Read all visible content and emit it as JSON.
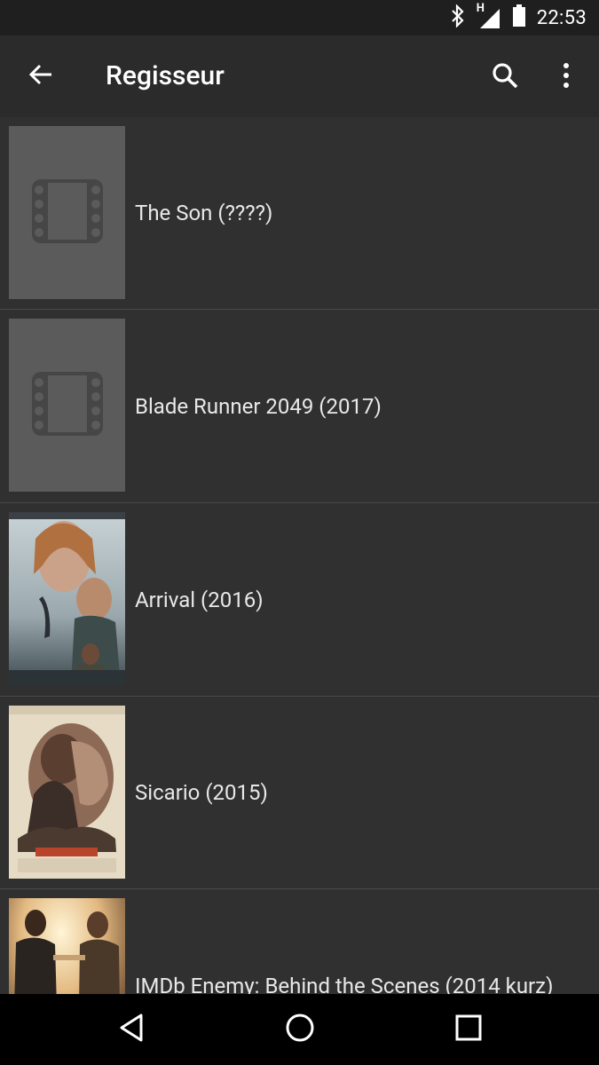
{
  "status_bar": {
    "time": "22:53",
    "network_label": "H",
    "icons": [
      "bluetooth-icon",
      "signal-icon",
      "battery-icon"
    ]
  },
  "app_bar": {
    "title": "Regisseur",
    "icons": [
      "back-arrow-icon",
      "search-icon",
      "more-vert-icon"
    ]
  },
  "items": [
    {
      "title": "The Son (????)",
      "poster": "placeholder"
    },
    {
      "title": "Blade Runner 2049 (2017)",
      "poster": "placeholder"
    },
    {
      "title": "Arrival (2016)",
      "poster": "image"
    },
    {
      "title": "Sicario (2015)",
      "poster": "image"
    },
    {
      "title": "IMDb Enemy: Behind the Scenes (2014 kurz)",
      "poster": "image"
    }
  ],
  "nav_bar": {
    "icons": [
      "back-triangle-icon",
      "home-circle-icon",
      "recents-square-icon"
    ]
  },
  "colors": {
    "status_bar": "#1f1f1f",
    "app_bar": "#2b2b2b",
    "background": "#303030",
    "divider": "#4a4a4a",
    "placeholder": "#5b5b5b",
    "nav_bar": "#000000"
  }
}
